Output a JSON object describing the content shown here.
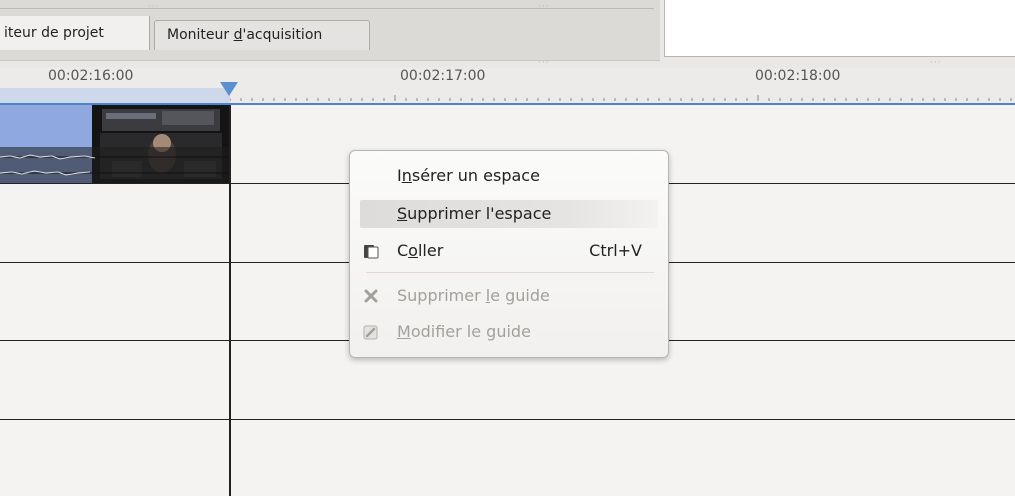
{
  "tabs": {
    "active": "iteur de projet",
    "inactive_before": "Moniteur ",
    "inactive_mnemonic": "d",
    "inactive_after": "'acquisition"
  },
  "ruler": {
    "ticks": [
      "00:02:16:00",
      "00:02:17:00",
      "00:02:18:00"
    ]
  },
  "menu": {
    "items": [
      {
        "label_pre": "I",
        "label_mnemonic": "n",
        "label_post": "sérer un espace",
        "shortcut": "",
        "icon": "",
        "disabled": false
      },
      {
        "label_pre": "",
        "label_mnemonic": "S",
        "label_post": "upprimer l'espace",
        "shortcut": "",
        "icon": "",
        "disabled": false,
        "highlighted": true
      },
      {
        "label_pre": "C",
        "label_mnemonic": "o",
        "label_post": "ller",
        "shortcut": "Ctrl+V",
        "icon": "paste-icon",
        "disabled": false
      },
      {
        "label_pre": "Supprimer ",
        "label_mnemonic": "l",
        "label_post": "e guide",
        "shortcut": "",
        "icon": "delete-x-icon",
        "disabled": true
      },
      {
        "label_pre": "",
        "label_mnemonic": "M",
        "label_post": "odifier le guide",
        "shortcut": "",
        "icon": "edit-pencil-icon",
        "disabled": true
      }
    ]
  },
  "colors": {
    "playhead": "#5b8fd0",
    "clip_blue": "#8fa8e0",
    "menu_highlight": "#dedcda",
    "disabled_text": "#a3a09c"
  }
}
